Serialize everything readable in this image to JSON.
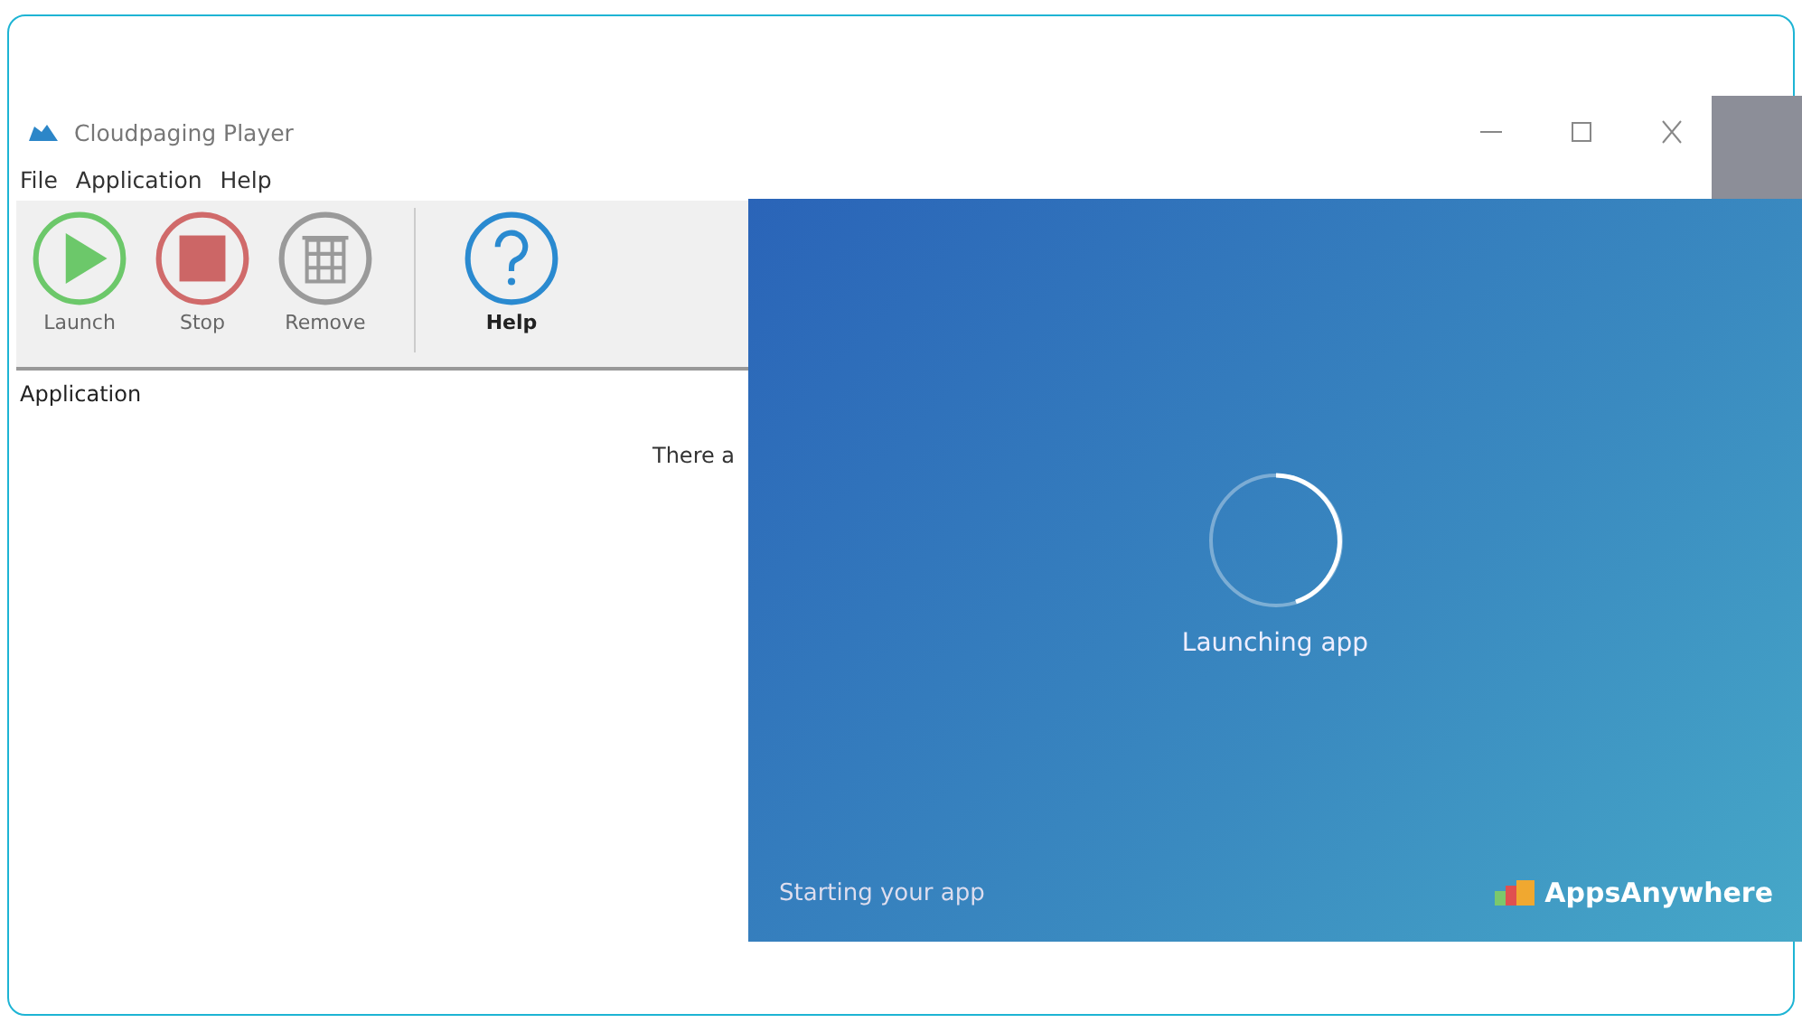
{
  "window": {
    "title": "Cloudpaging Player"
  },
  "menu": [
    "File",
    "Application",
    "Help"
  ],
  "toolbar": [
    {
      "kind": "launch",
      "label": "Launch"
    },
    {
      "kind": "stop",
      "label": "Stop"
    },
    {
      "kind": "remove",
      "label": "Remove"
    },
    {
      "kind": "help",
      "label": "Help"
    }
  ],
  "list": {
    "column": "Application",
    "message": "There a"
  },
  "splash": {
    "status": "Launching app",
    "footer": "Starting your app",
    "brand": "AppsAnywhere"
  }
}
